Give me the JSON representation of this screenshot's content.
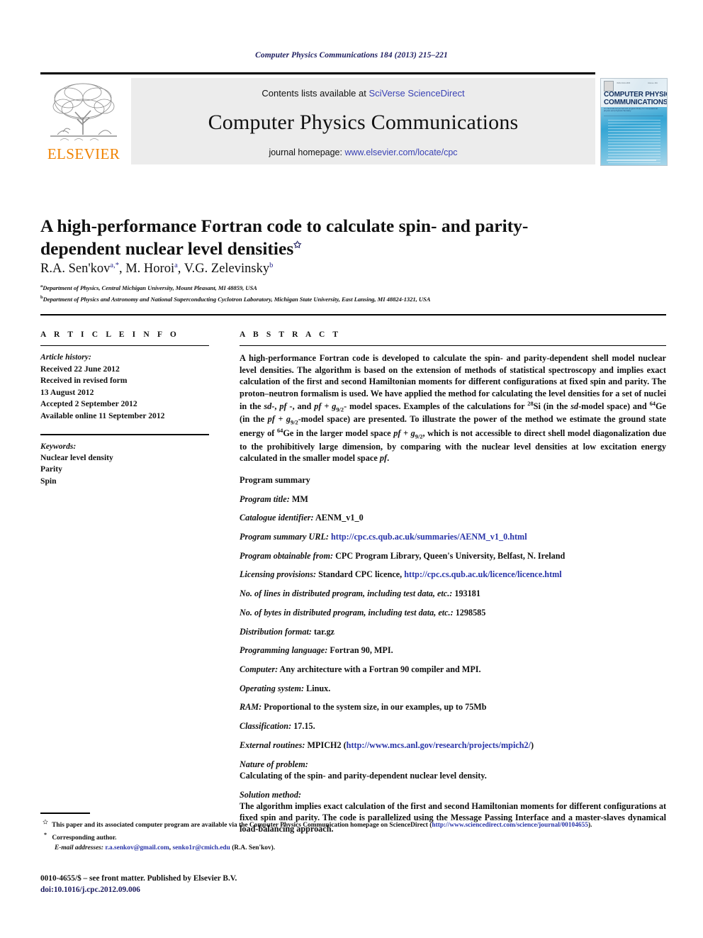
{
  "running_head": "Computer Physics Communications 184 (2013) 215–221",
  "masthead": {
    "contents_prefix": "Contents lists available at ",
    "contents_link": "SciVerse ScienceDirect",
    "journal_name": "Computer Physics Communications",
    "homepage_prefix": "journal homepage: ",
    "homepage_link": "www.elsevier.com/locate/cpc",
    "publisher_wordmark": "ELSEVIER",
    "cover": {
      "title_line1": "COMPUTER PHYSICS",
      "title_line2": "COMMUNICATIONS",
      "subtitle": "An international journal and program library for computational physics and physical chemistry"
    }
  },
  "article": {
    "title": "A high-performance Fortran code to calculate spin- and parity-dependent nuclear level densities",
    "title_footnote_mark": "✩",
    "authors": [
      {
        "name": "R.A. Sen'kov",
        "sup": "a,*"
      },
      {
        "name": "M. Horoi",
        "sup": "a"
      },
      {
        "name": "V.G. Zelevinsky",
        "sup": "b"
      }
    ],
    "affiliations": [
      {
        "mark": "a",
        "text": "Department of Physics, Central Michigan University, Mount Pleasant, MI 48859, USA"
      },
      {
        "mark": "b",
        "text": "Department of Physics and Astronomy and National Superconducting Cyclotron Laboratory, Michigan State University, East Lansing, MI 48824-1321, USA"
      }
    ]
  },
  "article_info": {
    "heading": "A R T I C L E   I N F O",
    "history_label": "Article history:",
    "history": [
      "Received 22 June 2012",
      "Received in revised form",
      "13 August 2012",
      "Accepted 2 September 2012",
      "Available online 11 September 2012"
    ],
    "keywords_label": "Keywords:",
    "keywords": [
      "Nuclear level density",
      "Parity",
      "Spin"
    ]
  },
  "abstract": {
    "heading": "A B S T R A C T",
    "text_part1": "A high-performance Fortran code is developed to calculate the spin- and parity-dependent shell model nuclear level densities. The algorithm is based on the extension of methods of statistical spectroscopy and implies exact calculation of the first and second Hamiltonian moments for different configurations at fixed spin and parity. The proton–neutron formalism is used. We have applied the method for calculating the level densities for a set of nuclei in the ",
    "space_sd": "sd-",
    "mid1": ", ",
    "space_pf": "pf -",
    "mid2": ", and ",
    "space_pfg": "pf + g",
    "space_pfg_sub": "9/2",
    "mid3": "- model spaces. Examples of the calculations for ",
    "iso_si_sup": "28",
    "iso_si": "Si",
    "mid4": " (in the ",
    "sd2": "sd",
    "mid5": "-model space) and ",
    "iso_ge_sup": "64",
    "iso_ge": "Ge",
    "mid6": " (in the ",
    "pfg2": "pf + g",
    "pfg2_sub": "9/2",
    "mid7": "-model space) are presented. To illustrate the power of the method we estimate the ground state energy of ",
    "iso_ge2_sup": "64",
    "iso_ge2": "Ge",
    "mid8": " in the larger model space ",
    "pfg3": "pf + g",
    "pfg3_sub": "9/2",
    "mid9": ", which is not accessible to direct shell model diagonalization due to the prohibitively large dimension, by comparing with the nuclear level densities at low excitation energy calculated in the smaller model space ",
    "pf_end": "pf",
    "end": "."
  },
  "program_summary": {
    "heading": "Program summary",
    "items": [
      {
        "label": "Program title:",
        "value": " MM"
      },
      {
        "label": "Catalogue identifier:",
        "value": " AENM_v1_0"
      },
      {
        "label": "Program summary URL:",
        "value": " ",
        "link": "http://cpc.cs.qub.ac.uk/summaries/AENM_v1_0.html"
      },
      {
        "label": "Program obtainable from:",
        "value": " CPC Program Library, Queen's University, Belfast, N. Ireland"
      },
      {
        "label": "Licensing provisions:",
        "value": " Standard CPC licence, ",
        "link": "http://cpc.cs.qub.ac.uk/licence/licence.html"
      },
      {
        "label": "No. of lines in distributed program, including test data, etc.:",
        "value": " 193181"
      },
      {
        "label": "No. of bytes in distributed program, including test data, etc.:",
        "value": " 1298585"
      },
      {
        "label": "Distribution format:",
        "value": " tar.gz"
      },
      {
        "label": "Programming language:",
        "value": " Fortran 90, MPI."
      },
      {
        "label": "Computer:",
        "value": " Any architecture with a Fortran 90 compiler and MPI."
      },
      {
        "label": "Operating system:",
        "value": " Linux."
      },
      {
        "label": "RAM:",
        "value": " Proportional to the system size, in our examples, up to 75Mb"
      },
      {
        "label": "Classification:",
        "value": " 17.15."
      },
      {
        "label": "External routines:",
        "value": " MPICH2 (",
        "link": "http://www.mcs.anl.gov/research/projects/mpich2/",
        "value_after": ")"
      }
    ],
    "blocks": [
      {
        "label": "Nature of problem:",
        "text": "Calculating of the spin- and parity-dependent nuclear level density."
      },
      {
        "label": "Solution method:",
        "text": "The algorithm implies exact calculation of the first and second Hamiltonian moments for different configurations at fixed spin and parity. The code is parallelized using the Message Passing Interface and a master-slaves dynamical load-balancing approach."
      }
    ]
  },
  "footnotes": {
    "star_mark": "✩",
    "star_text_before": " This paper and its associated computer program are available via the Computer Physics Communication homepage on ScienceDirect  (",
    "star_link": "http://www.sciencedirect.com/science/journal/00104655",
    "star_text_after": ").",
    "corr_mark": "*",
    "corr_text": " Corresponding author.",
    "email_label": "E-mail addresses:",
    "email_1": "r.a.senkov@gmail.com",
    "email_sep": ", ",
    "email_2": "senko1r@cmich.edu",
    "email_suffix": " (R.A. Sen'kov)."
  },
  "imprint": {
    "issn_line": "0010-4655/$ – see front matter. Published by Elsevier B.V.",
    "doi_line": "doi:10.1016/j.cpc.2012.09.006"
  },
  "colors": {
    "link_blue": "#2a35a8",
    "header_navy": "#1b1b5e",
    "elsevier_orange": "#f08200",
    "banner_gray": "#ececec"
  }
}
